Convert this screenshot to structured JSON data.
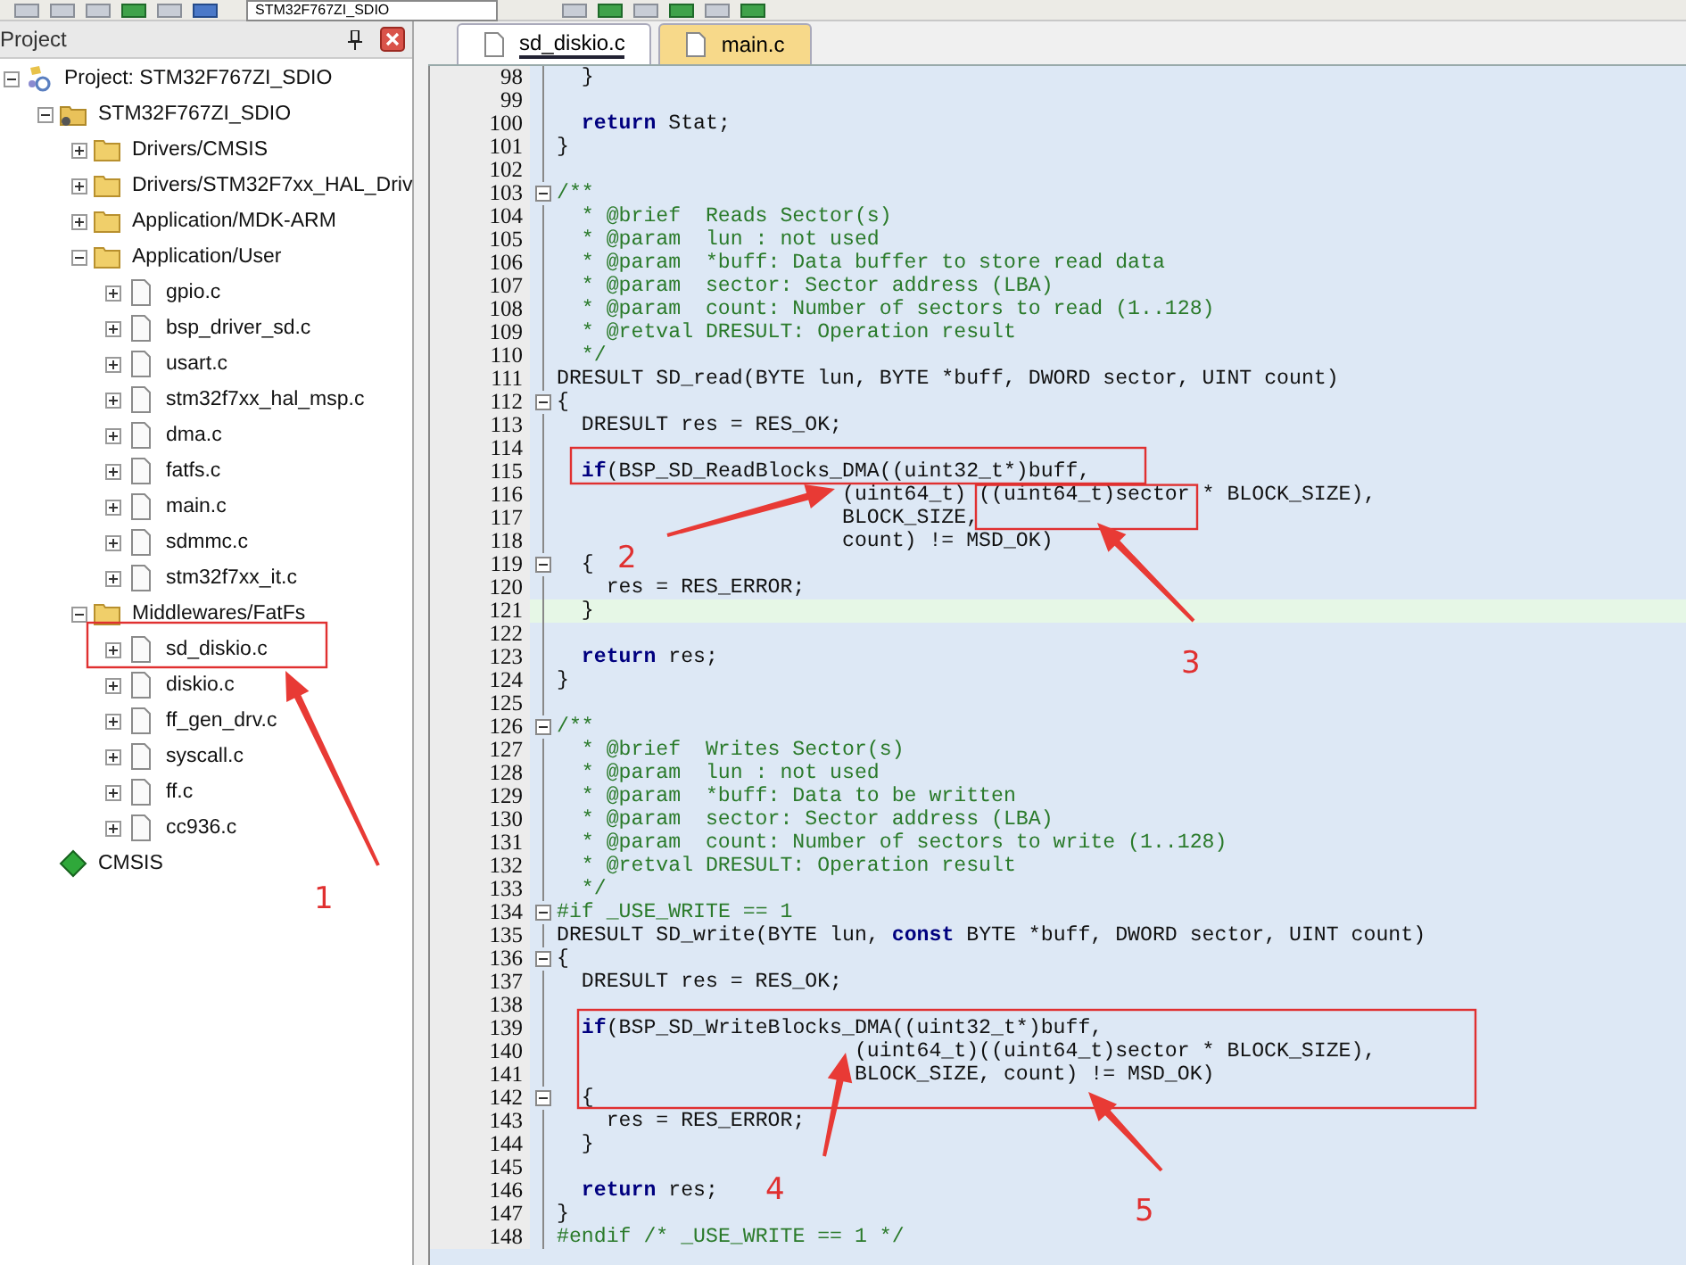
{
  "toolbar": {
    "target_dropdown": "STM32F767ZI_SDIO"
  },
  "panel": {
    "title": "Project",
    "tree": [
      {
        "label": "Project: STM32F767ZI_SDIO",
        "kind": "project",
        "expanded": true,
        "children": [
          {
            "label": "STM32F767ZI_SDIO",
            "kind": "target",
            "expanded": true,
            "children": [
              {
                "label": "Drivers/CMSIS",
                "kind": "folder",
                "expanded": false
              },
              {
                "label": "Drivers/STM32F7xx_HAL_Driv",
                "kind": "folder",
                "expanded": false
              },
              {
                "label": "Application/MDK-ARM",
                "kind": "folder",
                "expanded": false
              },
              {
                "label": "Application/User",
                "kind": "folder",
                "expanded": true,
                "children": [
                  {
                    "label": "gpio.c",
                    "kind": "file",
                    "expanded": false
                  },
                  {
                    "label": "bsp_driver_sd.c",
                    "kind": "file",
                    "expanded": false
                  },
                  {
                    "label": "usart.c",
                    "kind": "file",
                    "expanded": false
                  },
                  {
                    "label": "stm32f7xx_hal_msp.c",
                    "kind": "file",
                    "expanded": false
                  },
                  {
                    "label": "dma.c",
                    "kind": "file",
                    "expanded": false
                  },
                  {
                    "label": "fatfs.c",
                    "kind": "file",
                    "expanded": false
                  },
                  {
                    "label": "main.c",
                    "kind": "file",
                    "expanded": false
                  },
                  {
                    "label": "sdmmc.c",
                    "kind": "file",
                    "expanded": false
                  },
                  {
                    "label": "stm32f7xx_it.c",
                    "kind": "file",
                    "expanded": false
                  }
                ]
              },
              {
                "label": "Middlewares/FatFs",
                "kind": "folder",
                "expanded": true,
                "children": [
                  {
                    "label": "sd_diskio.c",
                    "kind": "file",
                    "expanded": false
                  },
                  {
                    "label": "diskio.c",
                    "kind": "file",
                    "expanded": false
                  },
                  {
                    "label": "ff_gen_drv.c",
                    "kind": "file",
                    "expanded": false
                  },
                  {
                    "label": "syscall.c",
                    "kind": "file",
                    "expanded": false
                  },
                  {
                    "label": "ff.c",
                    "kind": "file",
                    "expanded": false
                  },
                  {
                    "label": "cc936.c",
                    "kind": "file",
                    "expanded": false
                  }
                ]
              }
            ]
          },
          {
            "label": "CMSIS",
            "kind": "component"
          }
        ]
      }
    ]
  },
  "tabs": [
    {
      "label": "sd_diskio.c",
      "selected": true
    },
    {
      "label": "main.c",
      "selected": false
    }
  ],
  "editor": {
    "lines": [
      {
        "num": "98",
        "code": "  }",
        "kind": "code",
        "collapsible": false,
        "highlighted": false
      },
      {
        "num": "99",
        "collapsible": false,
        "highlighted": false
      },
      {
        "num": "100",
        "code": "  **return** Stat;",
        "kind": "code",
        "collapsible": false,
        "highlighted": false
      },
      {
        "num": "101",
        "code": "}",
        "kind": "code",
        "collapsible": false,
        "highlighted": false
      },
      {
        "num": "102",
        "collapsible": false,
        "highlighted": false
      },
      {
        "num": "103",
        "code": "/**",
        "kind": "comment",
        "collapsible": true,
        "highlighted": false
      },
      {
        "num": "104",
        "code": "  * @brief  Reads Sector(s)",
        "kind": "comment",
        "collapsible": false,
        "highlighted": false
      },
      {
        "num": "105",
        "code": "  * @param  lun : not used",
        "kind": "comment",
        "collapsible": false,
        "highlighted": false
      },
      {
        "num": "106",
        "code": "  * @param  *buff: Data buffer to store read data",
        "kind": "comment",
        "collapsible": false,
        "highlighted": false
      },
      {
        "num": "107",
        "code": "  * @param  sector: Sector address (LBA)",
        "kind": "comment",
        "collapsible": false,
        "highlighted": false
      },
      {
        "num": "108",
        "code": "  * @param  count: Number of sectors to read (1..128)",
        "kind": "comment",
        "collapsible": false,
        "highlighted": false
      },
      {
        "num": "109",
        "code": "  * @retval DRESULT: Operation result",
        "kind": "comment",
        "collapsible": false,
        "highlighted": false
      },
      {
        "num": "110",
        "code": "  */",
        "kind": "comment",
        "collapsible": false,
        "highlighted": false
      },
      {
        "num": "111",
        "code": "DRESULT SD_read(BYTE lun, BYTE *buff, DWORD sector, UINT count)",
        "kind": "code",
        "collapsible": false,
        "highlighted": false
      },
      {
        "num": "112",
        "code": "{",
        "kind": "code",
        "collapsible": true,
        "highlighted": false
      },
      {
        "num": "113",
        "code": "  DRESULT res = RES_OK;",
        "kind": "code",
        "collapsible": false,
        "highlighted": false
      },
      {
        "num": "114",
        "collapsible": false,
        "highlighted": false
      },
      {
        "num": "115",
        "code": "  **if**(BSP_SD_ReadBlocks_DMA((uint32_t*)buff,",
        "kind": "code",
        "collapsible": false,
        "highlighted": false
      },
      {
        "num": "116",
        "code": "                       (uint64_t) ((uint64_t)sector * BLOCK_SIZE),",
        "kind": "code",
        "collapsible": false,
        "highlighted": false
      },
      {
        "num": "117",
        "code": "                       BLOCK_SIZE,",
        "kind": "code",
        "collapsible": false,
        "highlighted": false
      },
      {
        "num": "118",
        "code": "                       count) != MSD_OK)",
        "kind": "code",
        "collapsible": false,
        "highlighted": false
      },
      {
        "num": "119",
        "code": "  {",
        "kind": "code",
        "collapsible": true,
        "highlighted": false
      },
      {
        "num": "120",
        "code": "    res = RES_ERROR;",
        "kind": "code",
        "collapsible": false,
        "highlighted": false
      },
      {
        "num": "121",
        "code": "  }",
        "kind": "code",
        "collapsible": false,
        "highlighted": true
      },
      {
        "num": "122",
        "collapsible": false,
        "highlighted": false
      },
      {
        "num": "123",
        "code": "  **return** res;",
        "kind": "code",
        "collapsible": false,
        "highlighted": false
      },
      {
        "num": "124",
        "code": "}",
        "kind": "code",
        "collapsible": false,
        "highlighted": false
      },
      {
        "num": "125",
        "collapsible": false,
        "highlighted": false
      },
      {
        "num": "126",
        "code": "/**",
        "kind": "comment",
        "collapsible": true,
        "highlighted": false
      },
      {
        "num": "127",
        "code": "  * @brief  Writes Sector(s)",
        "kind": "comment",
        "collapsible": false,
        "highlighted": false
      },
      {
        "num": "128",
        "code": "  * @param  lun : not used",
        "kind": "comment",
        "collapsible": false,
        "highlighted": false
      },
      {
        "num": "129",
        "code": "  * @param  *buff: Data to be written",
        "kind": "comment",
        "collapsible": false,
        "highlighted": false
      },
      {
        "num": "130",
        "code": "  * @param  sector: Sector address (LBA)",
        "kind": "comment",
        "collapsible": false,
        "highlighted": false
      },
      {
        "num": "131",
        "code": "  * @param  count: Number of sectors to write (1..128)",
        "kind": "comment",
        "collapsible": false,
        "highlighted": false
      },
      {
        "num": "132",
        "code": "  * @retval DRESULT: Operation result",
        "kind": "comment",
        "collapsible": false,
        "highlighted": false
      },
      {
        "num": "133",
        "code": "  */",
        "kind": "comment",
        "collapsible": false,
        "highlighted": false
      },
      {
        "num": "134",
        "code": "#if _USE_WRITE == 1",
        "kind": "comment",
        "collapsible": true,
        "highlighted": false
      },
      {
        "num": "135",
        "code": "DRESULT SD_write(BYTE lun, **const** BYTE *buff, DWORD sector, UINT count)",
        "kind": "code",
        "collapsible": false,
        "highlighted": false
      },
      {
        "num": "136",
        "code": "{",
        "kind": "code",
        "collapsible": true,
        "highlighted": false
      },
      {
        "num": "137",
        "code": "  DRESULT res = RES_OK;",
        "kind": "code",
        "collapsible": false,
        "highlighted": false
      },
      {
        "num": "138",
        "collapsible": false,
        "highlighted": false
      },
      {
        "num": "139",
        "code": "  **if**(BSP_SD_WriteBlocks_DMA((uint32_t*)buff,",
        "kind": "code",
        "collapsible": false,
        "highlighted": false
      },
      {
        "num": "140",
        "code": "                        (uint64_t)((uint64_t)sector * BLOCK_SIZE),",
        "kind": "code",
        "collapsible": false,
        "highlighted": false
      },
      {
        "num": "141",
        "code": "                        BLOCK_SIZE, count) != MSD_OK)",
        "kind": "code",
        "collapsible": false,
        "highlighted": false
      },
      {
        "num": "142",
        "code": "  {",
        "kind": "code",
        "collapsible": true,
        "highlighted": false
      },
      {
        "num": "143",
        "code": "    res = RES_ERROR;",
        "kind": "code",
        "collapsible": false,
        "highlighted": false
      },
      {
        "num": "144",
        "code": "  }",
        "kind": "code",
        "collapsible": false,
        "highlighted": false
      },
      {
        "num": "145",
        "collapsible": false,
        "highlighted": false
      },
      {
        "num": "146",
        "code": "  **return** res;",
        "kind": "code",
        "collapsible": false,
        "highlighted": false
      },
      {
        "num": "147",
        "code": "}",
        "kind": "code",
        "collapsible": false,
        "highlighted": false
      },
      {
        "num": "148",
        "code": "#endif /* _USE_WRITE == 1 */",
        "kind": "comment",
        "collapsible": false,
        "highlighted": false
      }
    ]
  },
  "annotations": [
    {
      "label": "1"
    },
    {
      "label": "2"
    },
    {
      "label": "3"
    },
    {
      "label": "4"
    },
    {
      "label": "5"
    }
  ]
}
